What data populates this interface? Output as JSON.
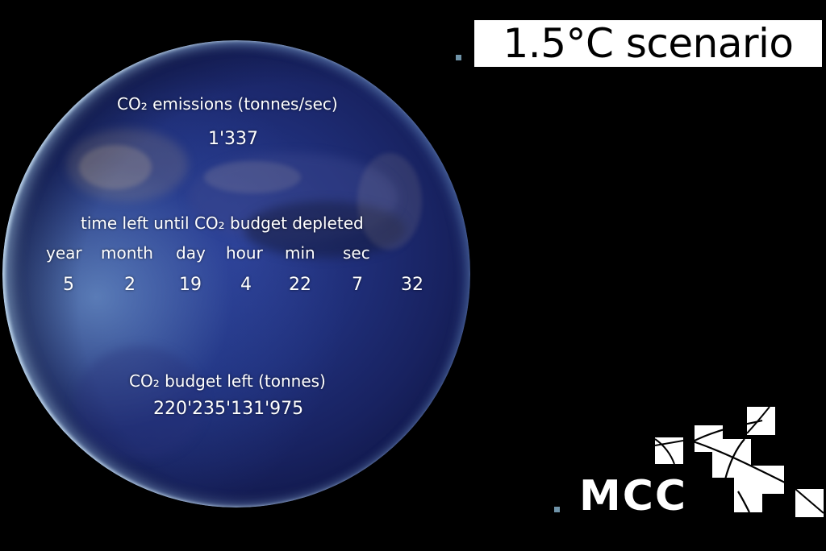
{
  "scenario": {
    "title": "1.5°C scenario"
  },
  "emissions": {
    "label": "CO₂ emissions (tonnes/sec)",
    "value": "1'337"
  },
  "countdown": {
    "label": "time left until CO₂ budget depleted",
    "units": [
      "year",
      "month",
      "day",
      "hour",
      "min",
      "sec"
    ],
    "values": [
      "5",
      "2",
      "19",
      "4",
      "22",
      "7",
      "32"
    ]
  },
  "budget": {
    "label": "CO₂ budget left (tonnes)",
    "value": "220'235'131'975"
  },
  "logo": {
    "text": "MCC",
    "icon": "mcc-tiles-logo"
  },
  "colors": {
    "background": "#000000",
    "bullet": "#6f93a8",
    "globe_blue": "#1f2e78",
    "text": "#ffffff"
  }
}
